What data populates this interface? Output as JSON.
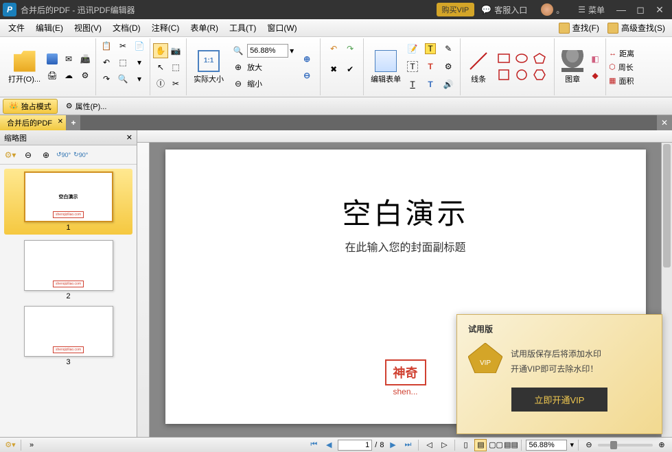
{
  "titlebar": {
    "doc_title": "合并后的PDF",
    "app_name": "迅讯PDF编辑器",
    "full_title": "合并后的PDF - 迅讯PDF编辑器",
    "vip_label": "购买VIP",
    "support_label": "客服入口",
    "user_status": "。",
    "menu_label": "菜单"
  },
  "menubar": {
    "items": [
      "文件",
      "编辑(E)",
      "视图(V)",
      "文档(D)",
      "注释(C)",
      "表单(R)",
      "工具(T)",
      "窗口(W)"
    ],
    "find_label": "查找(F)",
    "advfind_label": "高级查找(S)"
  },
  "ribbon": {
    "open_label": "打开(O)...",
    "actual_size": "实际大小",
    "zoom_value": "56.88%",
    "zoom_in": "放大",
    "zoom_out": "缩小",
    "edit_form": "编辑表单",
    "lines": "线条",
    "stamp": "图章",
    "distance": "距离",
    "perimeter": "周长",
    "area": "面积"
  },
  "modebar": {
    "exclusive": "独占模式",
    "properties": "属性(P)..."
  },
  "tabs": [
    {
      "label": "合并后的PDF"
    }
  ],
  "thumbnails": {
    "title": "缩略图",
    "tools_rot90": "90°",
    "tools_neg90": "90°",
    "pages": [
      {
        "num": "1",
        "title": "空白演示",
        "watermark": "shenqiziliao.com"
      },
      {
        "num": "2",
        "title": "",
        "watermark": "shenqiziliao.com"
      },
      {
        "num": "3",
        "title": "",
        "watermark": "shenqiziliao.com"
      }
    ]
  },
  "document": {
    "heading": "空白演示",
    "subtitle": "在此输入您的封面副标题",
    "stamp_text": "神奇",
    "stamp_url": "shen..."
  },
  "statusbar": {
    "page_current": "1",
    "page_total": "8",
    "page_sep": "/",
    "zoom_value": "56.88%"
  },
  "popup": {
    "title": "试用版",
    "line1": "试用版保存后将添加水印",
    "line2": "开通VIP即可去除水印！",
    "cta": "立即开通VIP",
    "badge_text": "VIP"
  }
}
